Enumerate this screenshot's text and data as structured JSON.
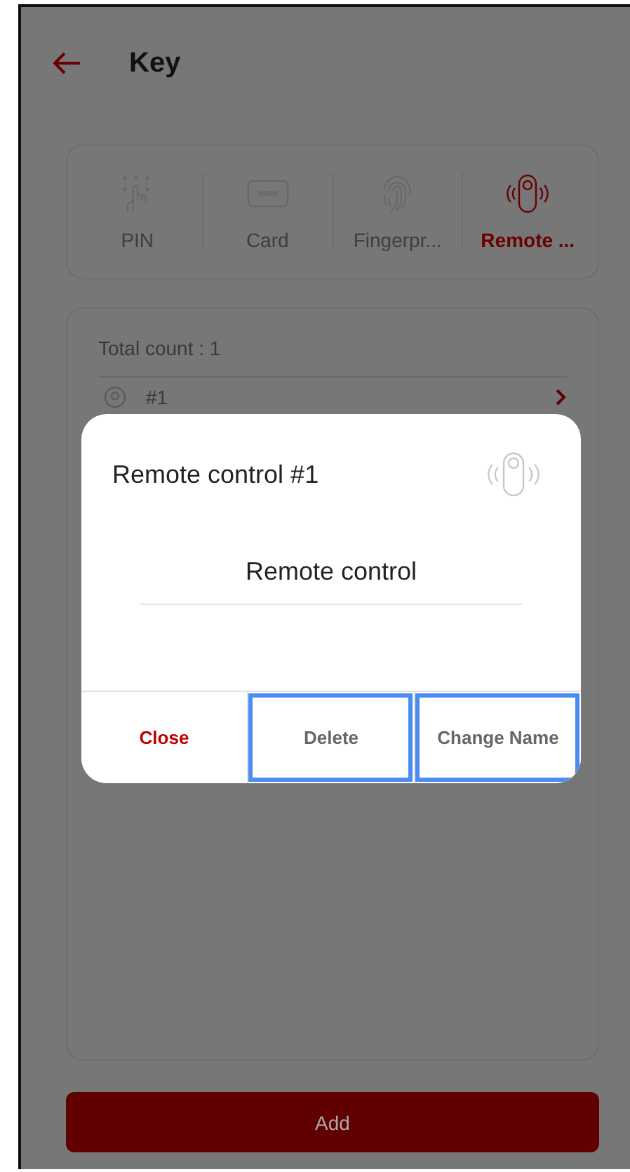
{
  "header": {
    "title": "Key"
  },
  "tabs": [
    {
      "kind": "pin",
      "label": "PIN",
      "selected": false
    },
    {
      "kind": "card",
      "label": "Card",
      "selected": false
    },
    {
      "kind": "fingerprint",
      "label": "Fingerpr...",
      "selected": false
    },
    {
      "kind": "remote",
      "label": "Remote ...",
      "selected": true
    }
  ],
  "list": {
    "total": "Total count : 1",
    "items": [
      {
        "label": "#1"
      }
    ]
  },
  "dialog": {
    "title": "Remote control #1",
    "name_value": "Remote control",
    "buttons": [
      {
        "kind": "cancel",
        "label": "Close",
        "highlighted": false
      },
      {
        "kind": "neutral",
        "label": "Delete",
        "highlighted": true
      },
      {
        "kind": "neutral",
        "label": "Change Name",
        "highlighted": true
      }
    ]
  },
  "add_button": {
    "label": "Add"
  }
}
